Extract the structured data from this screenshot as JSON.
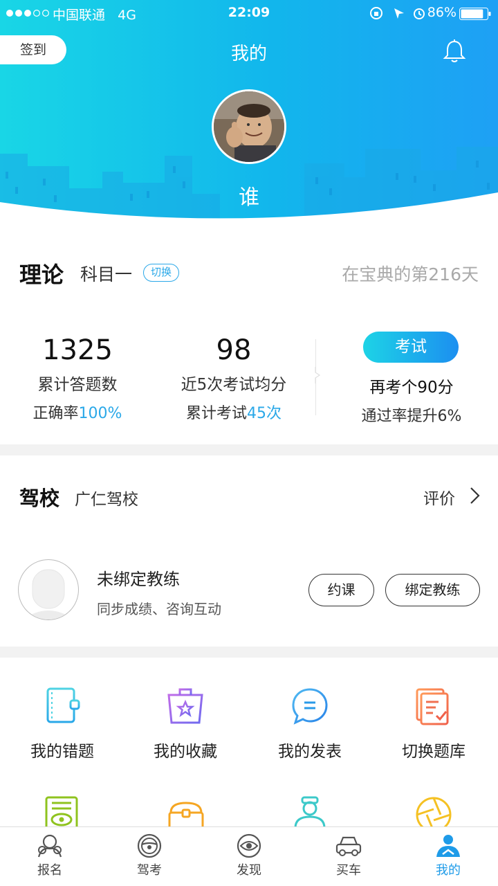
{
  "status_bar": {
    "carrier": "中国联通",
    "network": "4G",
    "time": "22:09",
    "battery": "86%",
    "battery_level": 0.86
  },
  "header": {
    "checkin_label": "签到",
    "title": "我的",
    "username": "谁"
  },
  "theory": {
    "title": "理论",
    "subject": "科目一",
    "switch_label": "切换",
    "days_info": "在宝典的第216天",
    "stats": [
      {
        "value": "1325",
        "label": "累计答题数",
        "sub_prefix": "正确率",
        "sub_value": "100%"
      },
      {
        "value": "98",
        "label": "近5次考试均分",
        "sub_prefix": "累计考试",
        "sub_value": "45次"
      }
    ],
    "exam": {
      "button_label": "考试",
      "line1": "再考个90分",
      "line2": "通过率提升6%"
    }
  },
  "school": {
    "title": "驾校",
    "name": "广仁驾校",
    "review_label": "评价",
    "coach_name": "未绑定教练",
    "coach_desc": "同步成绩、咨询互动",
    "book_label": "约课",
    "bind_label": "绑定教练"
  },
  "grid": {
    "items": [
      {
        "label": "我的错题",
        "icon": "notebook-icon"
      },
      {
        "label": "我的收藏",
        "icon": "star-bag-icon"
      },
      {
        "label": "我的发表",
        "icon": "chat-bubble-icon"
      },
      {
        "label": "切换题库",
        "icon": "question-bank-icon"
      }
    ],
    "row2_icons": [
      "eye-document-icon",
      "treasure-chest-icon",
      "coach-person-icon",
      "aperture-icon"
    ]
  },
  "tabs": [
    {
      "label": "报名",
      "icon": "signup-icon"
    },
    {
      "label": "驾考",
      "icon": "steering-wheel-icon"
    },
    {
      "label": "发现",
      "icon": "discover-icon"
    },
    {
      "label": "买车",
      "icon": "car-icon"
    },
    {
      "label": "我的",
      "icon": "profile-icon"
    }
  ],
  "active_tab": "我的",
  "colors": {
    "accent": "#1e9be8",
    "header_start": "#19d6e6",
    "header_end": "#1ea0f5"
  }
}
